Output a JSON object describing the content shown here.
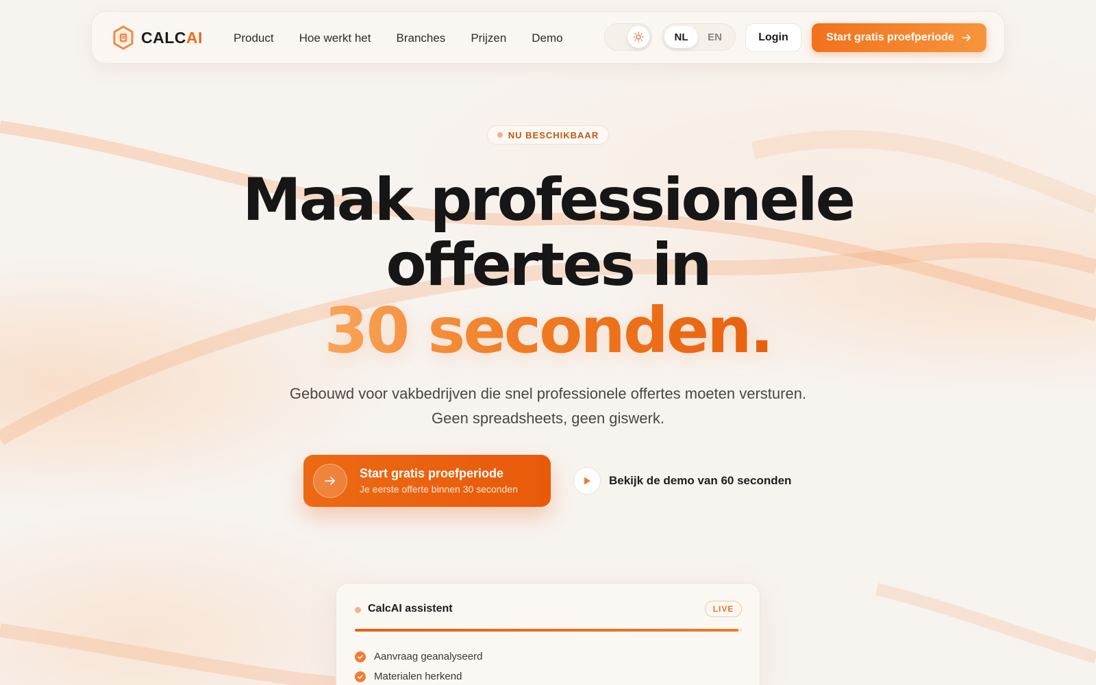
{
  "brand": {
    "name_main": "CALC",
    "name_accent": "AI"
  },
  "nav": {
    "items": [
      "Product",
      "Hoe werkt het",
      "Branches",
      "Prijzen",
      "Demo"
    ],
    "languages": [
      "NL",
      "EN"
    ],
    "active_language": "NL",
    "login": "Login",
    "cta": "Start gratis proefperiode"
  },
  "hero": {
    "badge": "NU BESCHIKBAAR",
    "line1": "Maak professionele",
    "line2": "offertes in",
    "line3": "30 seconden.",
    "subtitle": "Gebouwd voor vakbedrijven die snel professionele offertes moeten versturen. Geen spreadsheets, geen giswerk.",
    "cta_title": "Start gratis proefperiode",
    "cta_note": "Je eerste offerte binnen 30 seconden",
    "demo_label": "Bekijk de demo van 60 seconden"
  },
  "assistant": {
    "title": "CalcAI assistent",
    "status": "LIVE",
    "progress_percent": 99,
    "steps": [
      "Aanvraag geanalyseerd",
      "Materialen herkend"
    ]
  },
  "colors": {
    "accent": "#ee6a16",
    "accent_light": "#f7953c",
    "background": "#f7f3ef"
  },
  "icons": {
    "logo": "hexagon-document-icon",
    "theme": "sun-icon",
    "arrow": "arrow-right-icon",
    "play": "play-icon",
    "check": "check-icon"
  }
}
